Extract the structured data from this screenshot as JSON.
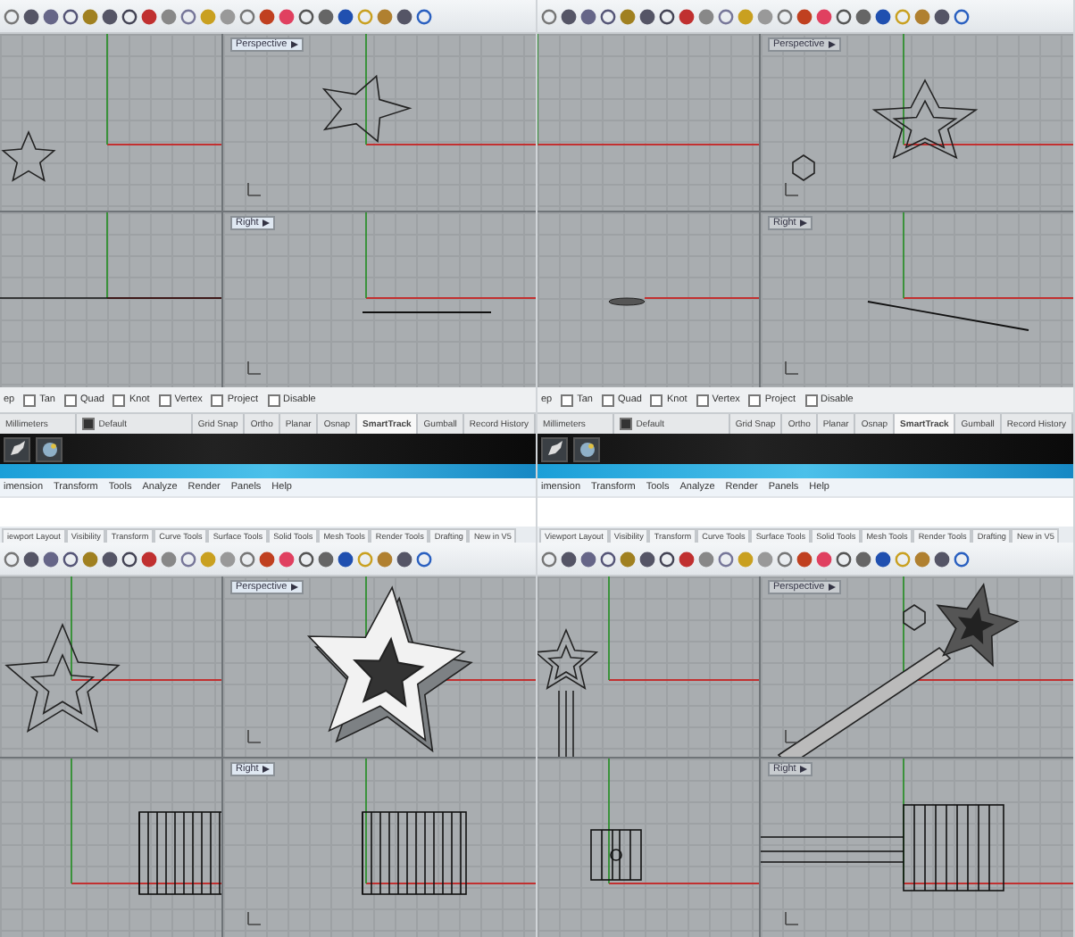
{
  "top_screens": [
    {
      "view_labels": [
        "Perspective",
        "Right"
      ],
      "osnap_lead": "ep",
      "osnaps": [
        {
          "label": "Tan",
          "checked": false
        },
        {
          "label": "Quad",
          "checked": false
        },
        {
          "label": "Knot",
          "checked": false
        },
        {
          "label": "Vertex",
          "checked": false
        },
        {
          "label": "Project",
          "checked": false
        },
        {
          "label": "Disable",
          "checked": false
        }
      ],
      "units": "Millimeters",
      "layer": "Default",
      "toggles": [
        {
          "label": "Grid Snap",
          "selected": false
        },
        {
          "label": "Ortho",
          "selected": false
        },
        {
          "label": "Planar",
          "selected": false
        },
        {
          "label": "Osnap",
          "selected": false
        },
        {
          "label": "SmartTrack",
          "selected": true
        },
        {
          "label": "Gumball",
          "selected": false
        },
        {
          "label": "Record History",
          "selected": false
        }
      ],
      "menu": [
        "imension",
        "Transform",
        "Tools",
        "Analyze",
        "Render",
        "Panels",
        "Help"
      ]
    },
    {
      "view_labels": [
        "Perspective",
        "Right"
      ],
      "osnap_lead": "ep",
      "osnaps": [
        {
          "label": "Tan",
          "checked": false
        },
        {
          "label": "Quad",
          "checked": false
        },
        {
          "label": "Knot",
          "checked": false
        },
        {
          "label": "Vertex",
          "checked": false
        },
        {
          "label": "Project",
          "checked": false
        },
        {
          "label": "Disable",
          "checked": false
        }
      ],
      "units": "Millimeters",
      "layer": "Default",
      "toggles": [
        {
          "label": "Grid Snap",
          "selected": false
        },
        {
          "label": "Ortho",
          "selected": false
        },
        {
          "label": "Planar",
          "selected": false
        },
        {
          "label": "Osnap",
          "selected": false
        },
        {
          "label": "SmartTrack",
          "selected": true
        },
        {
          "label": "Gumball",
          "selected": false
        },
        {
          "label": "Record History",
          "selected": false
        }
      ],
      "menu": [
        "imension",
        "Transform",
        "Tools",
        "Analyze",
        "Render",
        "Panels",
        "Help"
      ]
    }
  ],
  "bottom_screens": [
    {
      "tabs": [
        "iewport Layout",
        "Visibility",
        "Transform",
        "Curve Tools",
        "Surface Tools",
        "Solid Tools",
        "Mesh Tools",
        "Render Tools",
        "Drafting",
        "New in V5"
      ],
      "view_labels": [
        "Perspective",
        "Right"
      ]
    },
    {
      "tabs": [
        "Viewport Layout",
        "Visibility",
        "Transform",
        "Curve Tools",
        "Surface Tools",
        "Solid Tools",
        "Mesh Tools",
        "Render Tools",
        "Drafting",
        "New in V5"
      ],
      "view_labels": [
        "Perspective",
        "Right"
      ]
    }
  ]
}
